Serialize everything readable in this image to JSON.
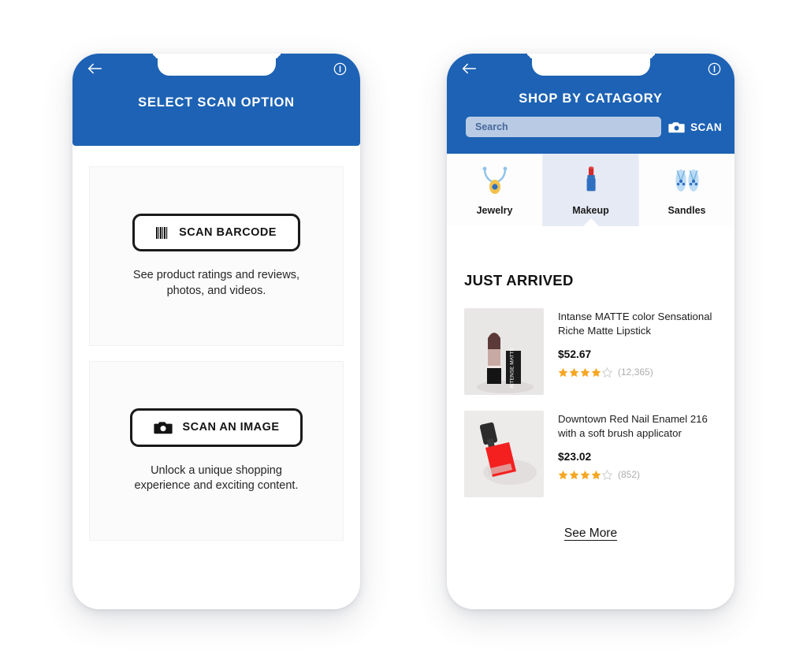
{
  "theme": {
    "brand_blue": "#1d62b4",
    "search_field": "#b9cbe4",
    "search_text": "#47679a",
    "tab_selected_bg": "#e5eaf4",
    "star_filled": "#f5a623",
    "star_empty": "#cfcfcf",
    "card_bg": "#fbfbfc"
  },
  "screen_left": {
    "header": {
      "title": "SELECT SCAN OPTION",
      "back_icon": "arrow-left-icon",
      "info_icon": "info-circle-icon"
    },
    "options": [
      {
        "icon": "barcode-icon",
        "button_label": "SCAN BARCODE",
        "description": "See product ratings and reviews, photos, and videos."
      },
      {
        "icon": "camera-icon",
        "button_label": "SCAN AN IMAGE",
        "description": "Unlock a unique shopping experience and exciting content."
      }
    ]
  },
  "screen_right": {
    "header": {
      "title": "SHOP BY CATAGORY",
      "back_icon": "arrow-left-icon",
      "info_icon": "info-circle-icon"
    },
    "search": {
      "value": "",
      "placeholder": "Search",
      "scan_label": "SCAN",
      "scan_icon": "camera-icon"
    },
    "tabs": [
      {
        "label": "Jewelry",
        "icon": "necklace-icon",
        "selected": false
      },
      {
        "label": "Makeup",
        "icon": "lipstick-icon",
        "selected": true
      },
      {
        "label": "Sandles",
        "icon": "flip-flops-icon",
        "selected": false
      }
    ],
    "section_title": "JUST ARRIVED",
    "products": [
      {
        "image": "lipstick-photo",
        "name": "Intanse MATTE color Sensational Riche Matte Lipstick",
        "price": "$52.67",
        "rating": 4,
        "rating_max": 5,
        "review_count": "(12,365)"
      },
      {
        "image": "nail-polish-photo",
        "name": "Downtown Red Nail Enamel 216 with a soft brush applicator",
        "price": "$23.02",
        "rating": 4,
        "rating_max": 5,
        "review_count": "(852)"
      }
    ],
    "see_more_label": "See More"
  }
}
